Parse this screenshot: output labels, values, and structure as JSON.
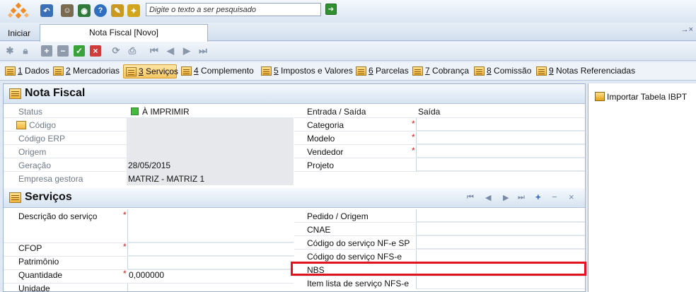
{
  "colors": {
    "accent": "#f2b53c",
    "required": "#d11919",
    "highlight": "#e1111f",
    "status_ok": "#46b93f"
  },
  "search": {
    "placeholder": "Digite o texto a ser pesquisado"
  },
  "tabs": {
    "home": "Iniciar",
    "document": "Nota Fiscal [Novo]"
  },
  "section_tabs": [
    {
      "key": "1",
      "label": " Dados"
    },
    {
      "key": "2",
      "label": " Mercadorias"
    },
    {
      "key": "3",
      "label": " Serviços"
    },
    {
      "key": "4",
      "label": " Complemento"
    },
    {
      "key": "5",
      "label": " Impostos e Valores"
    },
    {
      "key": "6",
      "label": " Parcelas"
    },
    {
      "key": "7",
      "label": " Cobrança"
    },
    {
      "key": "8",
      "label": " Comissão"
    },
    {
      "key": "9",
      "label": " Notas Referenciadas"
    }
  ],
  "nota_fiscal": {
    "title": "Nota Fiscal",
    "left": [
      {
        "label": "Status",
        "value": "À IMPRIMIR"
      },
      {
        "label": "Código",
        "value": ""
      },
      {
        "label": "Código ERP",
        "value": ""
      },
      {
        "label": "Origem",
        "value": ""
      },
      {
        "label": "Geração",
        "value": "28/05/2015"
      },
      {
        "label": "Empresa gestora",
        "value": "MATRIZ - MATRIZ 1"
      }
    ],
    "right": [
      {
        "label": "Entrada / Saída",
        "value": "Saída"
      },
      {
        "label": "Categoria",
        "value": ""
      },
      {
        "label": "Modelo",
        "value": ""
      },
      {
        "label": "Vendedor",
        "value": ""
      },
      {
        "label": "Projeto",
        "value": ""
      }
    ]
  },
  "servicos": {
    "title": "Serviços",
    "left": [
      {
        "label": "Descrição do serviço",
        "value": ""
      },
      {
        "label": "CFOP",
        "value": ""
      },
      {
        "label": "Patrimônio",
        "value": ""
      },
      {
        "label": "Quantidade",
        "value": "0,000000"
      },
      {
        "label": "Unidade",
        "value": ""
      }
    ],
    "right": [
      {
        "label": "Pedido / Origem",
        "value": ""
      },
      {
        "label": "CNAE",
        "value": ""
      },
      {
        "label": "Código do serviço NF-e SP",
        "value": ""
      },
      {
        "label": "Código do serviço NFS-e",
        "value": ""
      },
      {
        "label": "NBS",
        "value": ""
      },
      {
        "label": "Item lista de serviço NFS-e",
        "value": ""
      }
    ]
  },
  "side": {
    "import_label": "Importar Tabela IBPT"
  },
  "icons": {
    "top": [
      "back-arrow-icon",
      "users-icon",
      "eye-icon",
      "help-icon",
      "brush-icon",
      "wand-icon"
    ],
    "actions": [
      "new-record-icon",
      "lock-icon",
      "add-icon",
      "remove-icon",
      "confirm-icon",
      "cancel-icon",
      "refresh-icon",
      "print-icon",
      "first-icon",
      "prev-icon",
      "next-icon",
      "last-icon"
    ]
  }
}
